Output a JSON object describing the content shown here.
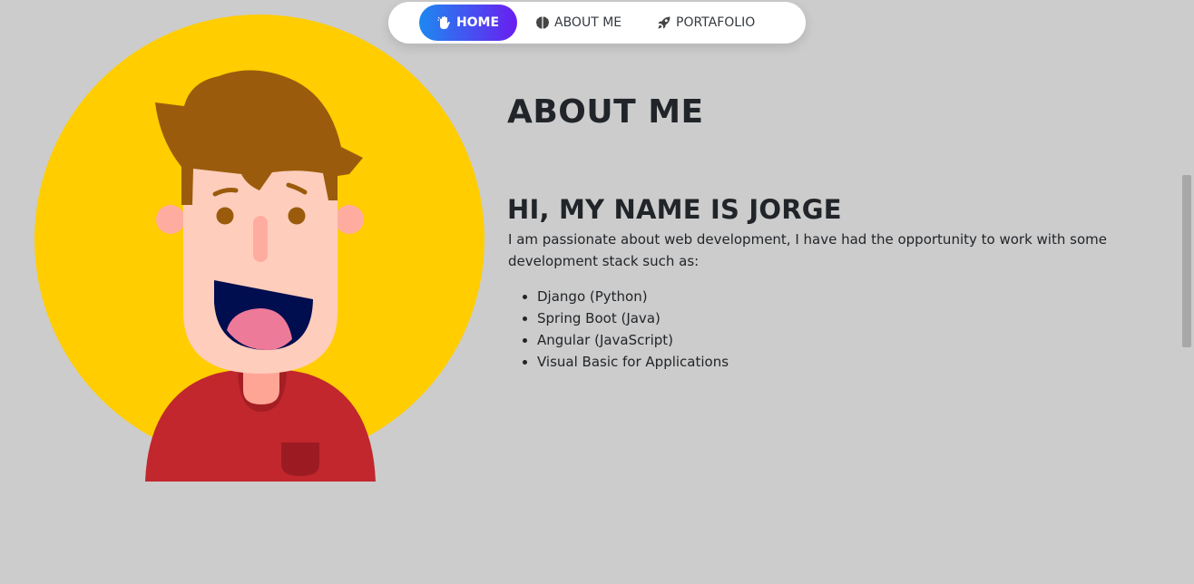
{
  "nav": {
    "items": [
      {
        "label": "HOME",
        "icon": "hand-icon",
        "active": true
      },
      {
        "label": "ABOUT ME",
        "icon": "brain-icon",
        "active": false
      },
      {
        "label": "PORTAFOLIO",
        "icon": "rocket-icon",
        "active": false
      }
    ],
    "active_gradient": [
      "#1e88f0",
      "#6a1ef0"
    ]
  },
  "about": {
    "title": "ABOUT ME",
    "greeting": "HI, MY NAME IS JORGE",
    "intro": "I am passionate about web development, I have had the opportunity to work with some development stack such as:",
    "stack": [
      "Django (Python)",
      "Spring Boot (Java)",
      "Angular (JavaScript)",
      "Visual Basic for Applications"
    ]
  },
  "avatar": {
    "icon": "avatar-illustration",
    "colors": {
      "background_circle": "#ffcd00",
      "hair": "#9a5c0c",
      "skin": "#ffcdbc",
      "shirt": "#c1272d",
      "mouth": "#000d4f",
      "tongue": "#ee7a9a"
    }
  },
  "colors": {
    "page_background": "#cccccc",
    "text": "#212529"
  }
}
